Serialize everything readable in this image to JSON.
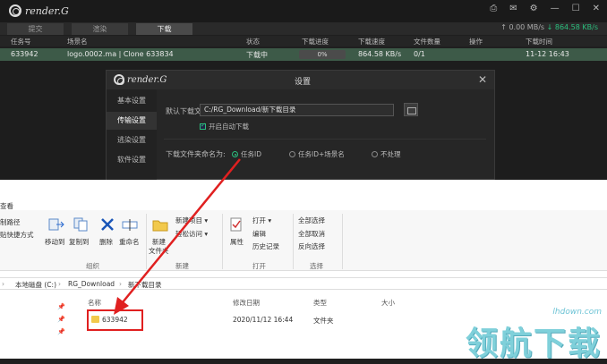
{
  "app": {
    "logo_text": "render.G"
  },
  "window_controls": [
    "⎙",
    "✉",
    "⚙",
    "—",
    "☐",
    "✕"
  ],
  "tabs": [
    {
      "label": "提交",
      "active": false
    },
    {
      "label": "渲染",
      "active": false
    },
    {
      "label": "下载",
      "active": true
    }
  ],
  "speed": {
    "up": "↑ 0.00 MB/s",
    "down": "↓ 864.58 KB/s"
  },
  "columns": {
    "task_id": "任务号",
    "scene": "场景名",
    "status": "状态",
    "progress": "下载进度",
    "speed": "下载速度",
    "file_count": "文件数量",
    "action": "操作",
    "time": "下载时间"
  },
  "task": {
    "id": "633942",
    "scene": "logo.0002.ma | Clone 633834",
    "status": "下载中",
    "progress": "0%",
    "speed": "864.58 KB/s",
    "file_count": "0/1",
    "time": "11-12 16:43"
  },
  "dialog": {
    "logo_text": "render.G",
    "title": "设置",
    "close": "✕",
    "side_items": [
      {
        "label": "基本设置",
        "active": false
      },
      {
        "label": "传输设置",
        "active": true
      },
      {
        "label": "逃染设置",
        "active": false
      },
      {
        "label": "软件设置",
        "active": false
      }
    ],
    "default_path_label": "默认下载文件到:",
    "default_path_value": "C:/RG_Download/新下载目录",
    "auto_download_label": "开启自动下载",
    "naming_label": "下载文件夹命名为:",
    "naming_options": [
      {
        "label": "任务ID",
        "selected": true
      },
      {
        "label": "任务ID+场景名",
        "selected": false
      },
      {
        "label": "不处理",
        "selected": false
      }
    ]
  },
  "explorer": {
    "title_fragment": "查看",
    "ribbon": {
      "copy_path": "制路径",
      "paste_shortcut": "贴快捷方式",
      "move_to": "移动到",
      "copy_to": "复制到",
      "delete": "删除",
      "rename": "重命名",
      "new_folder_line1": "新建",
      "new_folder_line2": "文件夹",
      "new_item": "新建项目 ▾",
      "easy_access": "轻松访问 ▾",
      "properties": "属性",
      "open": "打开 ▾",
      "edit": "编辑",
      "history": "历史记录",
      "select_all": "全部选择",
      "select_none": "全部取消",
      "invert_selection": "反向选择",
      "group_organize": "组织",
      "group_new": "新建",
      "group_open": "打开",
      "group_select": "选择"
    },
    "breadcrumb": [
      "本地磁盘 (C:)",
      "RG_Download",
      "新下载目录"
    ],
    "file_columns": {
      "name": "名称",
      "modified": "修改日期",
      "type": "类型",
      "size": "大小"
    },
    "file": {
      "name": "633942",
      "modified": "2020/11/12 16:44",
      "type": "文件夹"
    }
  },
  "watermark": {
    "site": "lhdown.com",
    "text": "领航下载"
  },
  "colors": {
    "accent_green": "#2bbf7e",
    "highlight_red": "#e02020",
    "row_bg": "#3d5a48"
  }
}
